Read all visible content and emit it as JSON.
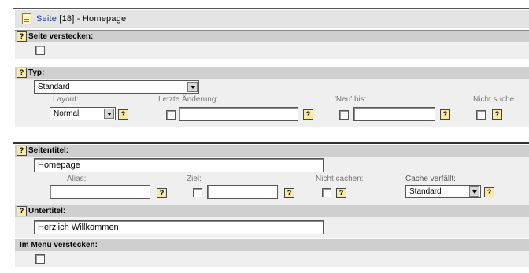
{
  "header": {
    "link_text": "Seite",
    "id_text": "[18]",
    "separator": " - ",
    "title": "Homepage"
  },
  "help_glyph": "?",
  "hide_page": {
    "label": "Seite verstecken:",
    "checked": false
  },
  "type": {
    "label": "Typ:",
    "selected": "Standard",
    "layout_label": "Layout:",
    "layout_selected": "Normal",
    "last_change_label": "Letzte Änderung:",
    "last_change_value": "",
    "new_until_label": "'Neu' bis:",
    "new_until_value": "",
    "no_search_label": "Nicht suche"
  },
  "page_title": {
    "label": "Seitentitel:",
    "value": "Homepage",
    "alias_label": "Alias:",
    "alias_value": "",
    "target_label": "Ziel:",
    "target_value": "",
    "no_cache_label": "Nicht cachen:",
    "cache_expires_label": "Cache verfällt:",
    "cache_expires_selected": "Standard"
  },
  "subtitle": {
    "label": "Untertitel:",
    "value": "Herzlich Willkommen"
  },
  "hide_in_menu": {
    "label": "Im Menü verstecken:",
    "checked": false
  }
}
